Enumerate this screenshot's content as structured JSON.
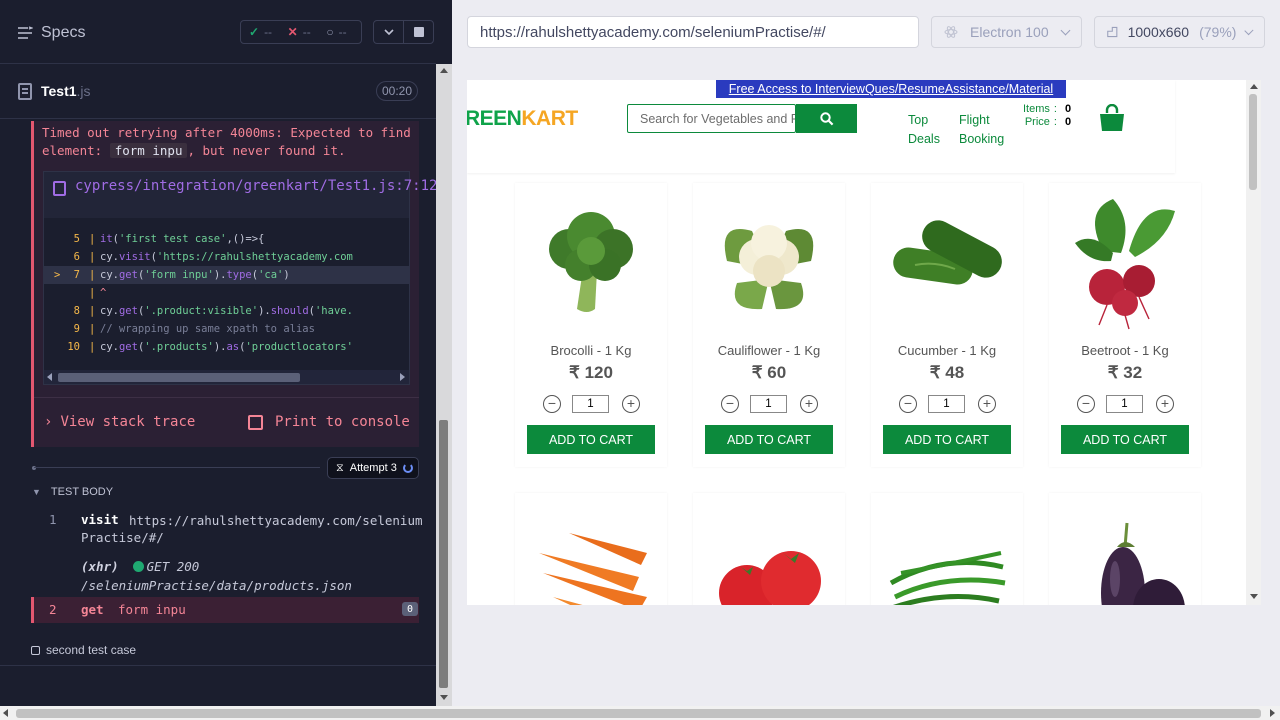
{
  "reporter": {
    "specs_label": "Specs",
    "stats": {
      "passed": "--",
      "failed": "--",
      "pending": "--"
    },
    "spec": {
      "name": "Test1",
      "ext": ".js",
      "duration": "00:20"
    },
    "error": {
      "message_pre": "Timed out retrying after 4000ms: Expected to find element: ",
      "selector": "form inpu",
      "message_post": ", but never found it.",
      "file_path": "cypress/integration/greenkart/Test1.js:7:12",
      "code_lines": [
        {
          "num": "5",
          "marker": "",
          "text": "it('first test case',()=>{"
        },
        {
          "num": "6",
          "marker": "",
          "text": "    cy.visit('https://rahulshettyacademy.com"
        },
        {
          "num": "7",
          "marker": ">",
          "text": "    cy.get('form inpu').type('ca')"
        },
        {
          "num": "",
          "marker": "",
          "text": "         ^"
        },
        {
          "num": "8",
          "marker": "",
          "text": "    cy.get('.product:visible').should('have."
        },
        {
          "num": "9",
          "marker": "",
          "text": "    // wrapping up same xpath to alias"
        },
        {
          "num": "10",
          "marker": "",
          "text": "    cy.get('.products').as('productlocators'"
        }
      ],
      "view_stack": "View stack trace",
      "print_console": "Print to console"
    },
    "attempt": "Attempt 3",
    "test_body_label": "TEST BODY",
    "commands": [
      {
        "num": "1",
        "name": "visit",
        "message": "https://rahulshettyacademy.com/selenium",
        "message2": "Practise/#/"
      },
      {
        "num": "2",
        "name": "get",
        "message": "form inpu",
        "badge": "0"
      }
    ],
    "xhr": {
      "label": "(xhr)",
      "method": "GET 200",
      "path": "/seleniumPractise/data/products.json"
    },
    "second_test": "second test case"
  },
  "aut": {
    "url": "https://rahulshettyacademy.com/seleniumPractise/#/",
    "browser": "Electron 100",
    "viewport": "1000x660",
    "zoom": "(79%)",
    "site": {
      "top_link": "Free Access to InterviewQues/ResumeAssistance/Material",
      "logo_a": "REEN",
      "logo_b": "KART",
      "search_placeholder": "Search for Vegetables and Fruits",
      "nav_top": [
        "Top",
        "Deals"
      ],
      "nav_flight": [
        "Flight",
        "Booking"
      ],
      "cart_items_label": "Items",
      "cart_items": "0",
      "cart_price_label": "Price",
      "cart_price": "0",
      "products": [
        {
          "name": "Brocolli - 1 Kg",
          "price": "₹ 120",
          "qty": "1",
          "button": "ADD TO CART",
          "icon": "broccoli-image"
        },
        {
          "name": "Cauliflower - 1 Kg",
          "price": "₹ 60",
          "qty": "1",
          "button": "ADD TO CART",
          "icon": "cauliflower-image"
        },
        {
          "name": "Cucumber - 1 Kg",
          "price": "₹ 48",
          "qty": "1",
          "button": "ADD TO CART",
          "icon": "cucumber-image"
        },
        {
          "name": "Beetroot - 1 Kg",
          "price": "₹ 32",
          "qty": "1",
          "button": "ADD TO CART",
          "icon": "beetroot-image"
        }
      ],
      "products_row2_icons": [
        "carrot-image",
        "tomato-image",
        "beans-image",
        "brinjal-image"
      ]
    },
    "colors": {
      "brand_green": "#0c8a3c",
      "logo_orange": "#f5a623",
      "error_red": "#e45770"
    }
  }
}
